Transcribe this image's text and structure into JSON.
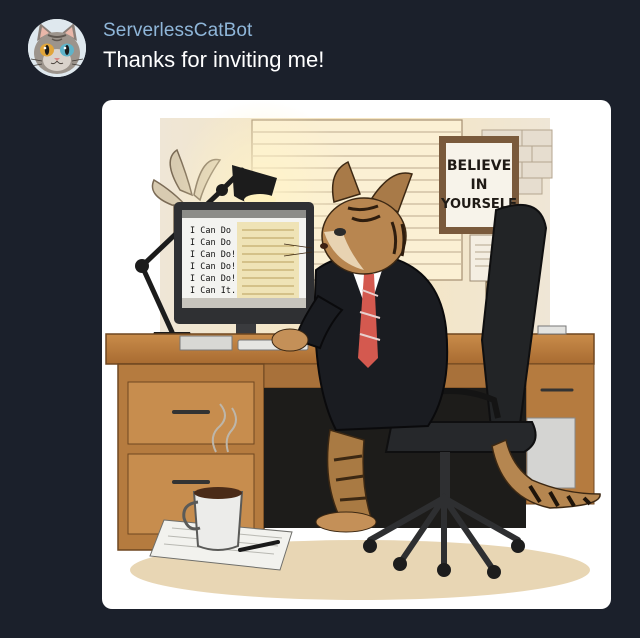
{
  "message": {
    "author": "ServerlessCatBot",
    "text": "Thanks for inviting me!",
    "avatar_icon": "cat-face-icon"
  },
  "attachment": {
    "poster_lines": [
      "BELIEVE",
      "IN",
      "YOURSELF"
    ],
    "screen_lines": [
      "I Can Do",
      "I Can Do",
      "I Can Do!",
      "I Can Do!",
      "I Can Do!",
      "I Can It."
    ]
  },
  "colors": {
    "background": "#1b202b",
    "author": "#8fb6d9",
    "text": "#ffffff"
  }
}
